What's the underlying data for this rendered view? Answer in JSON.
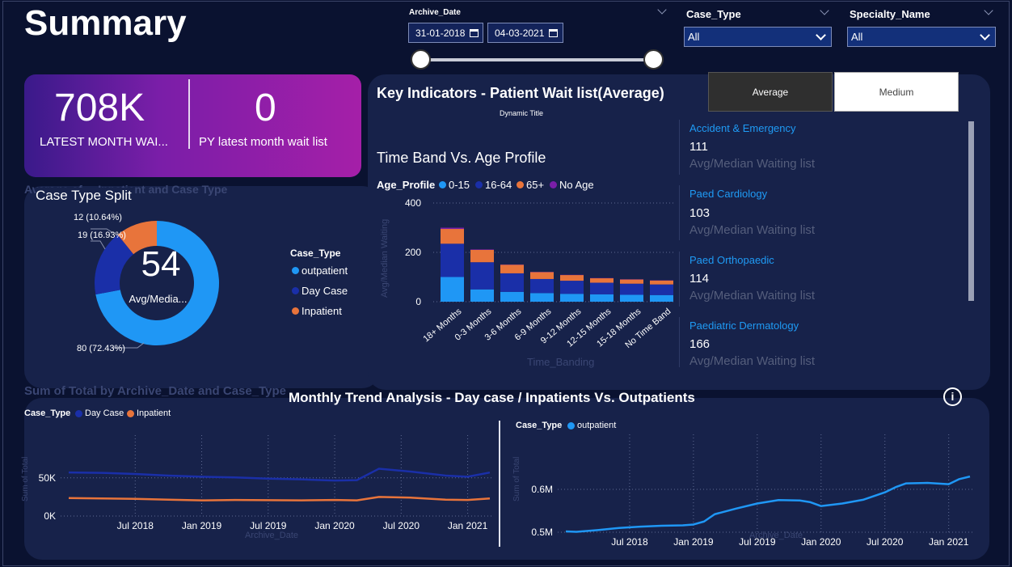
{
  "page": {
    "title": "Summary"
  },
  "filters": {
    "archive_date_label": "Archive_Date",
    "date_from": "31-01-2018",
    "date_to": "04-03-2021",
    "case_type_label": "Case_Type",
    "case_type_value": "All",
    "specialty_label": "Specialty_Name",
    "specialty_value": "All"
  },
  "kpi": {
    "latest_value": "708K",
    "latest_label": "LATEST MONTH WAI...",
    "py_value": "0",
    "py_label": "PY latest month wait list"
  },
  "case_split": {
    "title": "Case Type Split",
    "ghost_title": "Average of ... Inpatient and Case Type",
    "center_value": "54",
    "center_label": "Avg/Media...",
    "slice_labels": [
      "80 (72.43%)",
      "19 (16.93%)",
      "12 (10.64%)"
    ],
    "legend_title": "Case_Type",
    "legend": [
      "outpatient",
      "Day Case",
      "Inpatient"
    ]
  },
  "key_indicators": {
    "title": "Key Indicators - Patient Wait list(Average)",
    "dynamic_title": "Dynamic Title",
    "buttons": [
      "Average",
      "Medium"
    ],
    "items": [
      {
        "name": "Accident & Emergency",
        "value": "111",
        "sub": "Avg/Median Waiting list"
      },
      {
        "name": "Paed Cardiology",
        "value": "103",
        "sub": "Avg/Median Waiting list"
      },
      {
        "name": "Paed Orthopaedic",
        "value": "114",
        "sub": "Avg/Median Waiting list"
      },
      {
        "name": "Paediatric Dermatology",
        "value": "166",
        "sub": "Avg/Median Waiting list"
      }
    ]
  },
  "time_band": {
    "title": "Time Band Vs. Age Profile",
    "legend_title": "Age_Profile",
    "legend": [
      "0-15",
      "16-64",
      "65+",
      "No Age"
    ],
    "ghost_ylabel": "Avg/Median Waiting",
    "ghost_xlabel": "Time_Banding"
  },
  "trend": {
    "title": "Monthly Trend Analysis - Day case / Inpatients  Vs. Outpatients",
    "ghost_title": "Sum of Total by Archive_Date and Case_Type",
    "ghost_xlabel": "Archive_Date",
    "ghost_ylabel": "Sum of Total",
    "info_icon": "i",
    "left_legend_title": "Case_Type",
    "left_legend": [
      "Day Case",
      "Inpatient"
    ],
    "right_legend_title": "Case_Type",
    "right_legend": [
      "outpatient"
    ]
  },
  "colors": {
    "outpatient": "#1f97f5",
    "day_case": "#1a2fa8",
    "inpatient": "#e8743b",
    "no_age": "#7a1ea8",
    "indicator_name": "#1f9bf5"
  },
  "chart_data": [
    {
      "type": "pie",
      "title": "Case Type Split",
      "categories": [
        "outpatient",
        "Day Case",
        "Inpatient"
      ],
      "values": [
        80,
        19,
        12
      ],
      "percent_labels": [
        "72.43%",
        "16.93%",
        "10.64%"
      ],
      "center_value": 54
    },
    {
      "type": "bar",
      "stacked": true,
      "title": "Time Band Vs. Age Profile",
      "categories": [
        "18+ Months",
        "0-3 Months",
        "3-6 Months",
        "6-9 Months",
        "9-12 Months",
        "12-15 Months",
        "15-18 Months",
        "No Time Band"
      ],
      "series": [
        {
          "name": "0-15",
          "values": [
            100,
            50,
            40,
            35,
            32,
            30,
            28,
            27
          ]
        },
        {
          "name": "16-64",
          "values": [
            135,
            110,
            75,
            57,
            53,
            47,
            45,
            43
          ]
        },
        {
          "name": "65+",
          "values": [
            60,
            50,
            35,
            28,
            23,
            18,
            17,
            16
          ]
        },
        {
          "name": "No Age",
          "values": [
            5,
            2,
            1,
            1,
            1,
            1,
            1,
            1
          ]
        }
      ],
      "ylim": [
        0,
        400
      ],
      "yticks": [
        0,
        200,
        400
      ],
      "grid": true,
      "legend": "top-left"
    },
    {
      "type": "line",
      "title": "Day case / Inpatients",
      "x_range": [
        "2018-01",
        "2021-03"
      ],
      "xticks": [
        "Jul 2018",
        "Jan 2019",
        "Jul 2019",
        "Jan 2020",
        "Jul 2020",
        "Jan 2021"
      ],
      "yticks": [
        "0K",
        "50K"
      ],
      "ylim": [
        0,
        90000
      ],
      "series": [
        {
          "name": "Day Case",
          "x": [
            "2018-01",
            "2018-04",
            "2018-07",
            "2018-10",
            "2019-01",
            "2019-04",
            "2019-07",
            "2019-10",
            "2020-01",
            "2020-03",
            "2020-05",
            "2020-08",
            "2020-11",
            "2021-01",
            "2021-03"
          ],
          "values": [
            57000,
            56500,
            55000,
            53000,
            51500,
            50500,
            49000,
            48000,
            46500,
            47000,
            62000,
            58000,
            53000,
            51500,
            57000
          ]
        },
        {
          "name": "Inpatient",
          "x": [
            "2018-01",
            "2018-04",
            "2018-07",
            "2018-10",
            "2019-01",
            "2019-04",
            "2019-07",
            "2019-10",
            "2020-01",
            "2020-03",
            "2020-05",
            "2020-08",
            "2020-11",
            "2021-01",
            "2021-03"
          ],
          "values": [
            23500,
            23000,
            22500,
            21500,
            20500,
            21000,
            20800,
            20500,
            21000,
            20500,
            25000,
            24000,
            21500,
            21000,
            23000
          ]
        }
      ],
      "legend": "top-left"
    },
    {
      "type": "line",
      "title": "Outpatients",
      "x_range": [
        "2018-01",
        "2021-03"
      ],
      "xticks": [
        "Jul 2018",
        "Jan 2019",
        "Jul 2019",
        "Jan 2020",
        "Jul 2020",
        "Jan 2021"
      ],
      "yticks": [
        "0.5M",
        "0.6M"
      ],
      "ylim": [
        0.5,
        0.7
      ],
      "series": [
        {
          "name": "outpatient",
          "x": [
            "2018-01",
            "2018-02",
            "2018-04",
            "2018-06",
            "2018-08",
            "2018-10",
            "2018-12",
            "2019-01",
            "2019-02",
            "2019-03",
            "2019-05",
            "2019-07",
            "2019-09",
            "2019-11",
            "2019-12",
            "2020-01",
            "2020-03",
            "2020-05",
            "2020-07",
            "2020-08",
            "2020-09",
            "2020-11",
            "2021-01",
            "2021-02",
            "2021-03"
          ],
          "values": [
            0.502,
            0.501,
            0.505,
            0.51,
            0.513,
            0.515,
            0.516,
            0.518,
            0.525,
            0.542,
            0.555,
            0.567,
            0.575,
            0.574,
            0.57,
            0.561,
            0.567,
            0.576,
            0.593,
            0.605,
            0.614,
            0.615,
            0.612,
            0.624,
            0.63
          ]
        }
      ],
      "legend": "top-left"
    }
  ]
}
